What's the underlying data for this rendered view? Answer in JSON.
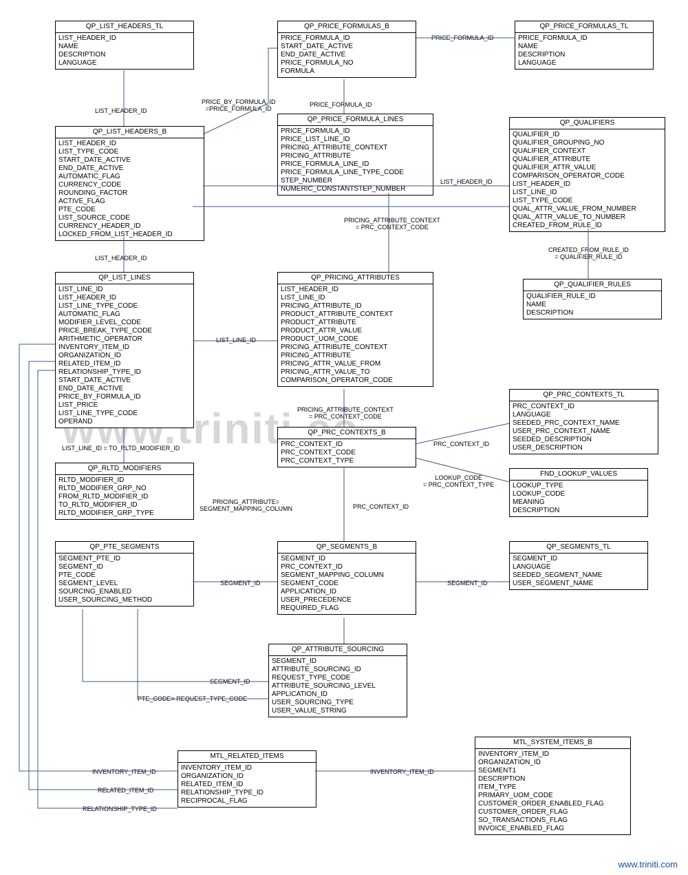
{
  "watermark": "www.triniti.co",
  "footer": "www.triniti.com",
  "entities": {
    "qp_list_headers_tl": {
      "title": "QP_LIST_HEADERS_TL",
      "fields": [
        "LIST_HEADER_ID",
        "NAME",
        "DESCRIPTION",
        "LANGUAGE"
      ]
    },
    "qp_price_formulas_b": {
      "title": "QP_PRICE_FORMULAS_B",
      "fields": [
        "PRICE_FORMULA_ID",
        "START_DATE_ACTIVE",
        "END_DATE_ACTIVE",
        "PRICE_FORMULA_NO",
        "FORMULA"
      ]
    },
    "qp_price_formulas_tl": {
      "title": "QP_PRICE_FORMULAS_TL",
      "fields": [
        "PRICE_FORMULA_ID",
        "NAME",
        "DESCRIPTION",
        "LANGUAGE"
      ]
    },
    "qp_list_headers_b": {
      "title": "QP_LIST_HEADERS_B",
      "fields": [
        "LIST_HEADER_ID",
        "LIST_TYPE_CODE",
        "START_DATE_ACTIVE",
        "END_DATE_ACTIVE",
        "AUTOMATIC_FLAG",
        "CURRENCY_CODE",
        "ROUNDING_FACTOR",
        "ACTIVE_FLAG",
        "PTE_CODE",
        "LIST_SOURCE_CODE",
        "CURRENCY_HEADER_ID",
        "LOCKED_FROM_LIST_HEADER_ID"
      ]
    },
    "qp_price_formula_lines": {
      "title": "QP_PRICE_FORMULA_LINES",
      "fields": [
        "PRICE_FORMULA_ID",
        "PRICE_LIST_LINE_ID",
        "PRICING_ATTRIBUTE_CONTEXT",
        "PRICING_ATTRIBUTE",
        "PRICE_FORMULA_LINE_ID",
        "PRICE_FORMULA_LINE_TYPE_CODE",
        "STEP_NUMBER",
        "NUMERIC_CONSTANTSTEP_NUMBER"
      ]
    },
    "qp_qualifiers": {
      "title": "QP_QUALIFIERS",
      "fields": [
        "QUALIFIER_ID",
        "QUALIFIER_GROUPING_NO",
        "QUALIFIER_CONTEXT",
        "QUALIFIER_ATTRIBUTE",
        "QUALIFIER_ATTR_VALUE",
        "COMPARISON_OPERATOR_CODE",
        "LIST_HEADER_ID",
        "LIST_LINE_ID",
        "LIST_TYPE_CODE",
        "QUAL_ATTR_VALUE_FROM_NUMBER",
        "QUAL_ATTR_VALUE_TO_NUMBER",
        "CREATED_FROM_RULE_ID"
      ]
    },
    "qp_list_lines": {
      "title": "QP_LIST_LINES",
      "fields": [
        "LIST_LINE_ID",
        "LIST_HEADER_ID",
        "LIST_LINE_TYPE_CODE",
        "AUTOMATIC_FLAG",
        "MODIFIER_LEVEL_CODE",
        "PRICE_BREAK_TYPE_CODE",
        "ARITHMETIC_OPERATOR",
        "INVENTORY_ITEM_ID",
        "ORGANIZATION_ID",
        "RELATED_ITEM_ID",
        "RELATIONSHIP_TYPE_ID",
        "START_DATE_ACTIVE",
        "END_DATE_ACTIVE",
        "PRICE_BY_FORMULA_ID",
        "LIST_PRICE",
        "LIST_LINE_TYPE_CODE",
        "OPERAND"
      ]
    },
    "qp_pricing_attributes": {
      "title": "QP_PRICING_ATTRIBUTES",
      "fields": [
        "LIST_HEADER_ID",
        "LIST_LINE_ID",
        "PRICING_ATTRIBUTE_ID",
        "PRODUCT_ATTRIBUTE_CONTEXT",
        "PRODUCT_ATTRIBUTE",
        "PRODUCT_ATTR_VALUE",
        "PRODUCT_UOM_CODE",
        "PRICING_ATTRIBUTE_CONTEXT",
        "PRICING_ATTRIBUTE",
        "PRICING_ATTR_VALUE_FROM",
        "PRICING_ATTR_VALUE_TO",
        "COMPARISON_OPERATOR_CODE"
      ]
    },
    "qp_qualifier_rules": {
      "title": "QP_QUALIFIER_RULES",
      "fields": [
        "QUALIFIER_RULE_ID",
        "NAME",
        "DESCRIPTION"
      ]
    },
    "qp_rltd_modifiers": {
      "title": "QP_RLTD_MODIFIERS",
      "fields": [
        "RLTD_MODIFIER_ID",
        "RLTD_MODIFIER_GRP_NO",
        "FROM_RLTD_MODIFIER_ID",
        "TO_RLTD_MODIFIER_ID",
        "RLTD_MODIFIER_GRP_TYPE"
      ]
    },
    "qp_prc_contexts_b": {
      "title": "QP_PRC_CONTEXTS_B",
      "fields": [
        "PRC_CONTEXT_ID",
        "PRC_CONTEXT_CODE",
        "PRC_CONTEXT_TYPE"
      ]
    },
    "qp_prc_contexts_tl": {
      "title": "QP_PRC_CONTEXTS_TL",
      "fields": [
        "PRC_CONTEXT_ID",
        "LANGUAGE",
        "SEEDED_PRC_CONTEXT_NAME",
        "USER_PRC_CONTEXT_NAME",
        "SEEDED_DESCRIPTION",
        "USER_DESCRIPTION"
      ]
    },
    "fnd_lookup_values": {
      "title": "FND_LOOKUP_VALUES",
      "fields": [
        "LOOKUP_TYPE",
        "LOOKUP_CODE",
        "MEANING",
        "DESCRIPTION"
      ]
    },
    "qp_pte_segments": {
      "title": "QP_PTE_SEGMENTS",
      "fields": [
        "SEGMENT_PTE_ID",
        "SEGMENT_ID",
        "PTE_CODE",
        "SEGMENT_LEVEL",
        "SOURCING_ENABLED",
        "USER_SOURCING_METHOD"
      ]
    },
    "qp_segments_b": {
      "title": "QP_SEGMENTS_B",
      "fields": [
        "SEGMENT_ID",
        "PRC_CONTEXT_ID",
        "SEGMENT_MAPPING_COLUMN",
        "SEGMENT_CODE",
        "APPLICATION_ID",
        "USER_PRECEDENCE",
        "REQUIRED_FLAG"
      ]
    },
    "qp_segments_tl": {
      "title": "QP_SEGMENTS_TL",
      "fields": [
        "SEGMENT_ID",
        "LANGUAGE",
        "SEEDED_SEGMENT_NAME",
        "USER_SEGMENT_NAME"
      ]
    },
    "qp_attribute_sourcing": {
      "title": "QP_ATTRIBUTE_SOURCING",
      "fields": [
        "SEGMENT_ID",
        "ATTRIBUTE_SOURCING_ID",
        "REQUEST_TYPE_CODE",
        "ATTRIBUTE_SOURCING_LEVEL",
        "APPLICATION_ID",
        "USER_SOURCING_TYPE",
        "USER_VALUE_STRING"
      ]
    },
    "mtl_related_items": {
      "title": "MTL_RELATED_ITEMS",
      "fields": [
        "INVENTORY_ITEM_ID",
        "ORGANIZATION_ID",
        "RELATED_ITEM_ID",
        "RELATIONSHIP_TYPE_ID",
        "RECIPROCAL_FLAG"
      ]
    },
    "mtl_system_items_b": {
      "title": "MTL_SYSTEM_ITEMS_B",
      "fields": [
        "INVENTORY_ITEM_ID",
        "ORGANIZATION_ID",
        "SEGMENT1",
        "DESCRIPTION",
        "ITEM_TYPE",
        "PRIMARY_UOM_CODE",
        "CUSTOMER_ORDER_ENABLED_FLAG",
        "CUSTOMER_ORDER_FLAG",
        "SO_TRANSACTIONS_FLAG",
        "INVOICE_ENABLED_FLAG"
      ]
    }
  },
  "labels": {
    "list_header_id_1": "LIST_HEADER_ID",
    "price_by_formula": "PRICE_BY_FORMULA_ID\n=PRICE_FORMULA_ID",
    "price_formula_id_1": "PRICE_FORMULA_ID",
    "price_formula_id_2": "PRICE_FORMULA_ID",
    "list_header_id_2": "LIST_HEADER_ID",
    "list_header_id_3": "LIST_HEADER_ID",
    "list_line_id_1": "LIST_LINE_ID",
    "list_line_id_2": "LIST_LINE_ID",
    "pricing_attr_ctx_1": "PRICING_ATTRIBUTE_CONTEXT\n= PRC_CONTEXT_CODE",
    "created_from_rule": "CREATED_FROM_RULE_ID\n= QUALIFIER_RULE_ID",
    "pricing_attr_ctx_2": "PRICING_ATTRIBUTE_CONTEXT\n= PRC_CONTEXT_CODE",
    "prc_context_id_1": "PRC_CONTEXT_ID",
    "prc_context_id_2": "PRC_CONTEXT_ID",
    "lookup_code": "LOOKUP_CODE\n= PRC_CONTEXT_TYPE",
    "list_line_to_modifier": "LIST_LINE_ID =  TO_RLTD_MODIFIER_ID",
    "pricing_attr_segment": "PRICING_ATTRIBUTE=\nSEGMENT_MAPPING_COLUMN",
    "segment_id_1": "SEGMENT_ID",
    "segment_id_2": "SEGMENT_ID",
    "segment_id_3": "SEGMENT_ID",
    "pte_code_req": "PTE_CODE=  REQUEST_TYPE_CODE",
    "inventory_item_id_1": "INVENTORY_ITEM_ID",
    "inventory_item_id_2": "INVENTORY_ITEM_ID",
    "related_item_id": "RELATED_ITEM_ID",
    "relationship_type_id": "RELATIONSHIP_TYPE_ID"
  }
}
